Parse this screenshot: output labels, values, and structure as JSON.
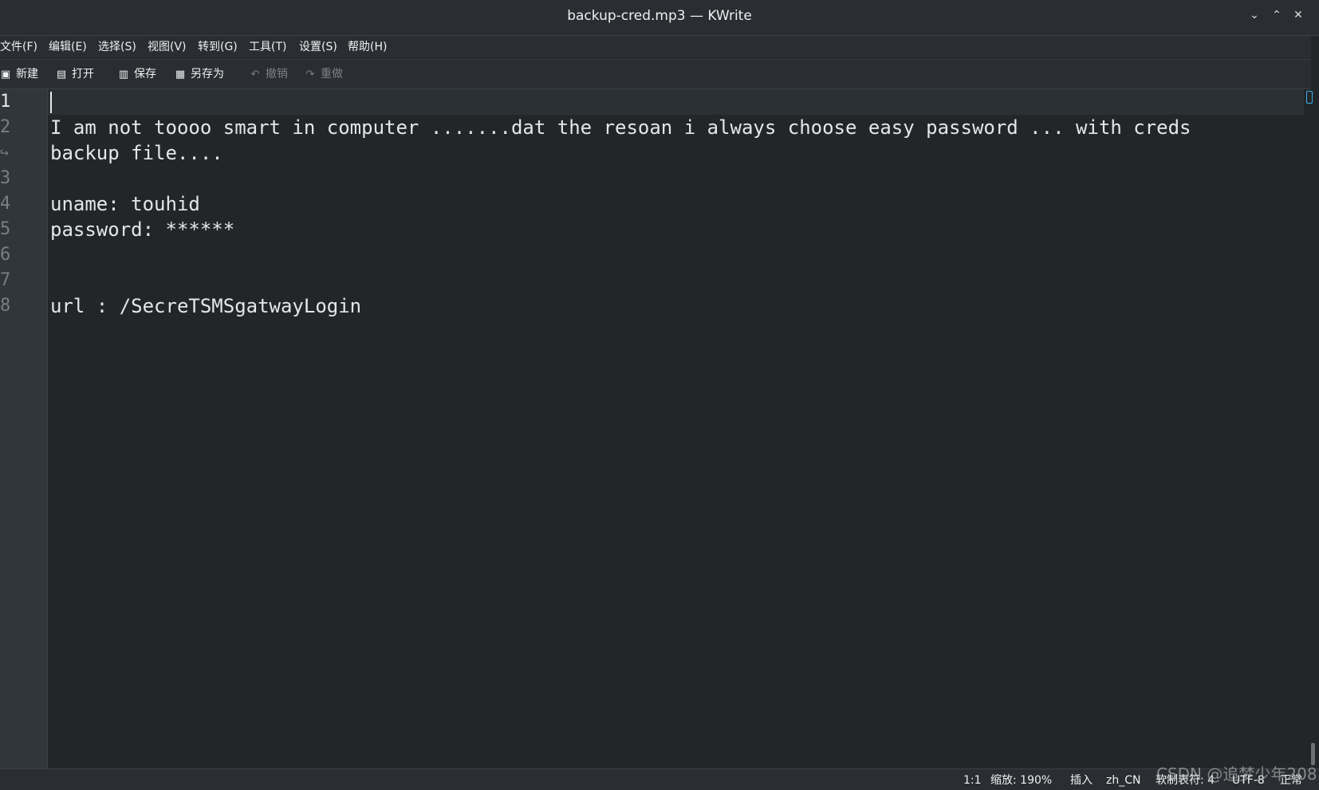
{
  "window": {
    "title": "backup-cred.mp3  — KWrite",
    "buttons": [
      {
        "icon": "chevron-down-icon",
        "glyph": "⌄"
      },
      {
        "icon": "chevron-up-icon",
        "glyph": "⌃"
      },
      {
        "icon": "close-icon",
        "glyph": "✕"
      }
    ]
  },
  "menubar": {
    "items": [
      "文件(F)",
      "编辑(E)",
      "选择(S)",
      "视图(V)",
      "转到(G)",
      "工具(T)",
      "设置(S)",
      "帮助(H)"
    ]
  },
  "toolbar": {
    "buttons": [
      {
        "label": "新建",
        "icon": "new-document-icon",
        "glyph": "▣",
        "enabled": true
      },
      {
        "label": "打开",
        "icon": "open-document-icon",
        "glyph": "▤",
        "enabled": true
      },
      {
        "label": "保存",
        "icon": "save-icon",
        "glyph": "▥",
        "enabled": true
      },
      {
        "label": "另存为",
        "icon": "save-as-icon",
        "glyph": "▦",
        "enabled": true
      },
      {
        "label": "撤销",
        "icon": "undo-icon",
        "glyph": "↶",
        "enabled": false
      },
      {
        "label": "重做",
        "icon": "redo-icon",
        "glyph": "↷",
        "enabled": false
      }
    ]
  },
  "editor": {
    "gutter": [
      "1",
      "2",
      "↪",
      "3",
      "4",
      "5",
      "6",
      "7",
      "8"
    ],
    "lines": [
      "",
      "I am not toooo smart in computer .......dat the resoan i always choose easy password ... with creds",
      "backup file....",
      "",
      "uname: touhid",
      "password: ******",
      "",
      "",
      "url : /SecreTSMSgatwayLogin"
    ]
  },
  "statusbar": {
    "cursor": "1:1",
    "zoom": "缩放: 190%",
    "mode": "插入",
    "language": "zh_CN",
    "indent": "软制表符: 4",
    "encoding": "UTF-8",
    "eol": "正常"
  },
  "watermark": "CSDN @追梦少年208"
}
